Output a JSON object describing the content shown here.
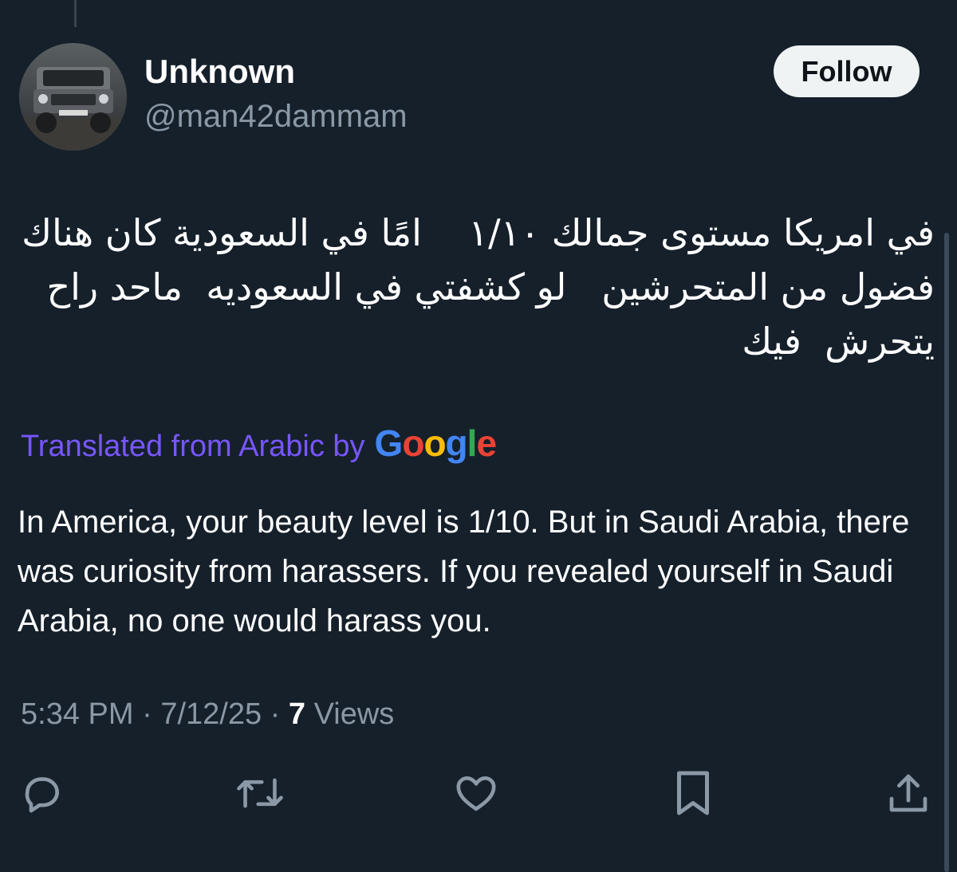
{
  "author": {
    "display_name": "Unknown",
    "handle": "@man42dammam",
    "avatar": "car-photo-avatar"
  },
  "follow_button": {
    "label": "Follow"
  },
  "tweet": {
    "original_text": "في امريكا مستوى جمالك ١/١٠    امًا في السعودية كان هناك فضول من المتحرشين   لو كشفتي في السعوديه  ماحد راح يتحرش  فيك",
    "translation_label": "Translated from Arabic by",
    "translation_provider": "Google",
    "translated_text": "In America, your beauty level is 1/10. But in Saudi Arabia, there was curiosity from harassers. If you revealed yourself in Saudi Arabia, no one would harass you."
  },
  "meta": {
    "time": "5:34 PM",
    "separator": "·",
    "date": "7/12/25",
    "views_count": "7",
    "views_label": "Views"
  },
  "actions": [
    {
      "name": "reply",
      "icon": "reply-icon"
    },
    {
      "name": "retweet",
      "icon": "retweet-icon"
    },
    {
      "name": "like",
      "icon": "heart-icon"
    },
    {
      "name": "bookmark",
      "icon": "bookmark-icon"
    },
    {
      "name": "share",
      "icon": "share-icon"
    }
  ],
  "colors": {
    "background": "#15202b",
    "secondary_text": "#8b98a5",
    "translation_accent": "#7856ff",
    "google_blue": "#4285f4",
    "google_red": "#ea4335",
    "google_yellow": "#fbbc05",
    "google_green": "#34a853"
  }
}
